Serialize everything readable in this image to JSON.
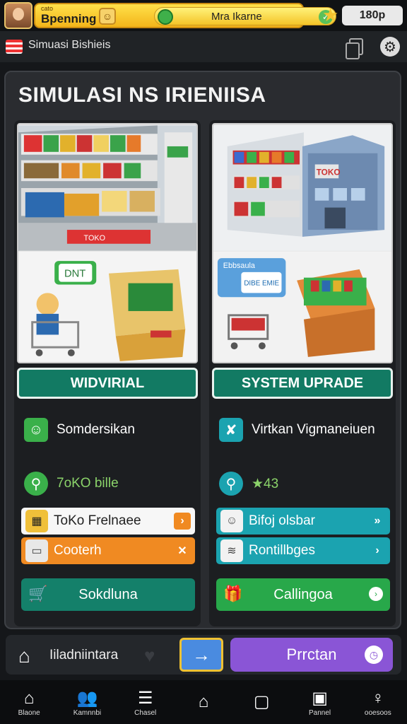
{
  "topbar": {
    "small_label": "cato",
    "player_name": "Bpenning",
    "pill_text": "Mra Ikarne",
    "score": "180p",
    "coin_icon": "gold-coin-icon",
    "star_icon": "star-icon"
  },
  "subbar": {
    "title": "Simuasi Bishieis"
  },
  "panel": {
    "title": "SIMULASI  NS IRIENIISA",
    "left": {
      "art_top_badge": "TOKO",
      "art_bubble": "DNT",
      "button": "WIDVIRIAL",
      "row1": "Somdersikan",
      "row2": "7oKO bille",
      "menu1": "ToKo Frelnaee",
      "menu2": "Cooterh",
      "big_button": "Sokdluna"
    },
    "right": {
      "art_building_sign": "TOKO",
      "art_bubble_title": "Ebbsaula",
      "art_bubble_body": "DIBE EMIE",
      "button": "SYSTEM UPRADE",
      "row1": "Virtkan Vigmaneiuen",
      "row2": "★43",
      "menu1": "Bifoj olsbar",
      "menu2": "Rontillbges",
      "big_button": "Callingoa"
    }
  },
  "actionbar": {
    "label": "Iiladniintara",
    "purple_button": "Prrctan"
  },
  "nav": {
    "items": [
      {
        "label": "Blaone",
        "icon": "house-icon"
      },
      {
        "label": "Kamnnbi",
        "icon": "people-icon"
      },
      {
        "label": "Chasel",
        "icon": "list-icon"
      },
      {
        "label": "",
        "icon": "home-outline-icon"
      },
      {
        "label": "",
        "icon": "square-icon"
      },
      {
        "label": "Pannel",
        "icon": "panel-icon"
      },
      {
        "label": "ooesoos",
        "icon": "person-pin-icon"
      }
    ]
  },
  "colors": {
    "gold": "#f3b51a",
    "teal_button": "#127a63",
    "orange_menu": "#f08a22",
    "teal_menu": "#1ba3b0",
    "green_button": "#28a84a",
    "purple_button": "#8a55d6",
    "blue_arrow": "#4a8be0"
  }
}
